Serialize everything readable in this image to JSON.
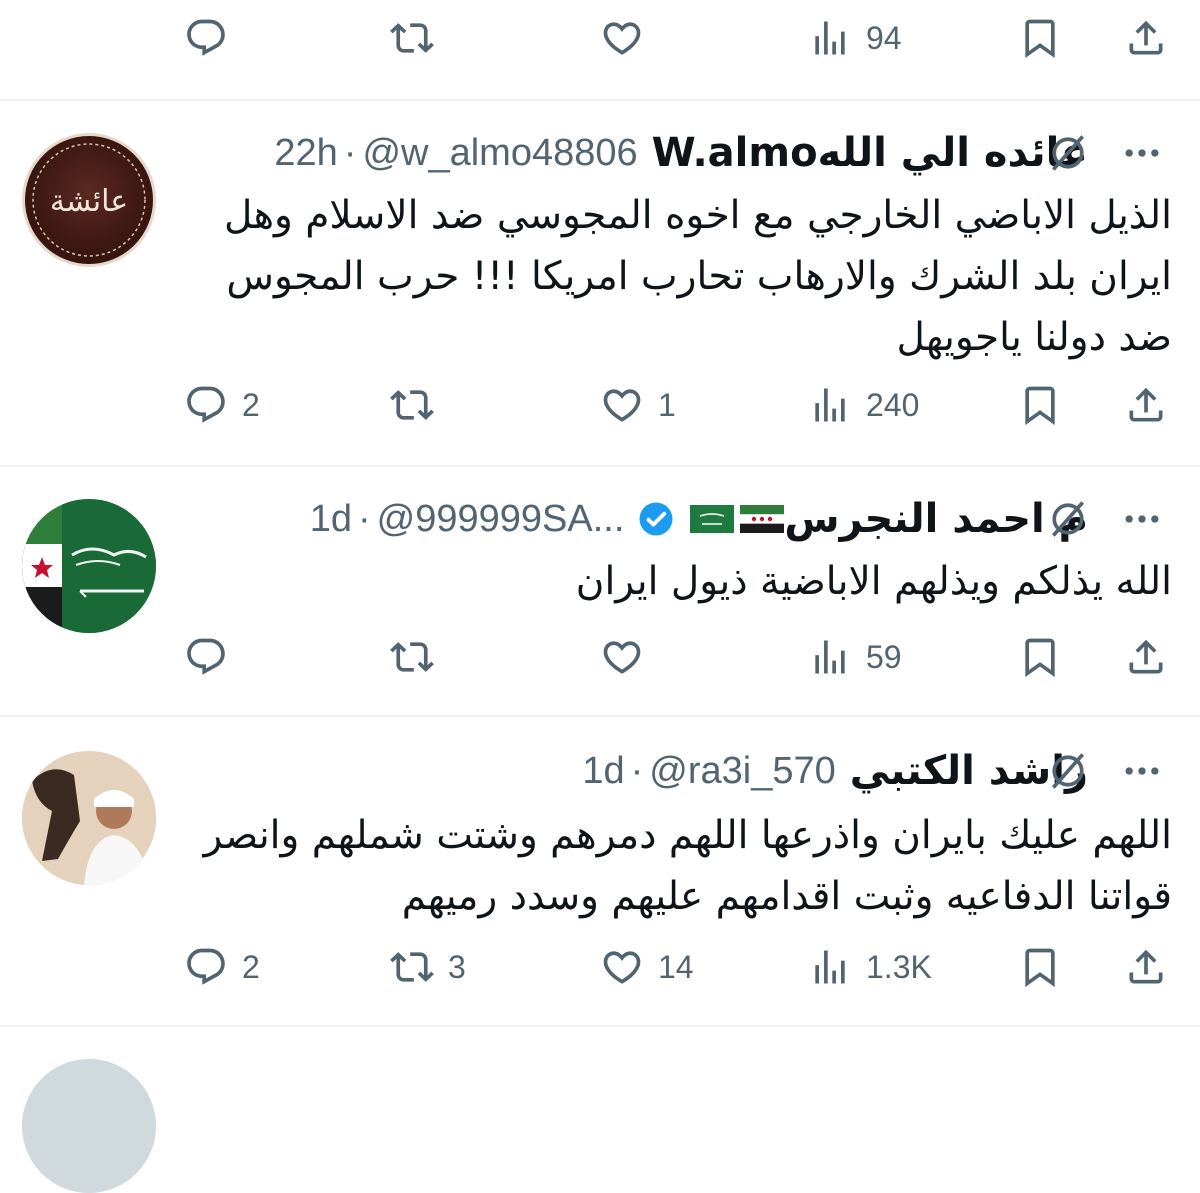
{
  "feed": {
    "top_actions": {
      "reply_count": "",
      "retweet_count": "",
      "like_count": "",
      "view_count": "94"
    },
    "tweets": [
      {
        "name": "عائده الي اللهW.almo",
        "handle": "@w_almo48806",
        "dot": "·",
        "time": "22h",
        "avatar_logo_text": "عائشة",
        "text": "الذيل الاباضي الخارجي مع اخوه المجوسي ضد الاسلام وهل ايران بلد الشرك والارهاب تحارب امريكا !!! حرب المجوس ضد دولنا ياجويهل",
        "reply_count": "2",
        "retweet_count": "",
        "like_count": "1",
        "view_count": "240"
      },
      {
        "name": "م احمد النجرس",
        "handle": "@999999SA...",
        "dot": "·",
        "time": "1d",
        "verified": true,
        "text": "الله يذلكم ويذلهم الاباضية ذيول ايران",
        "reply_count": "",
        "retweet_count": "",
        "like_count": "",
        "view_count": "59"
      },
      {
        "name": "راشد الكتبي",
        "handle": "@ra3i_570",
        "dot": "·",
        "time": "1d",
        "text": "اللهم عليك بايران واذرعها اللهم دمرهم وشتت شملهم وانصر قواتنا الدفاعيه وثبت اقدامهم عليهم وسدد رميهم",
        "reply_count": "2",
        "retweet_count": "3",
        "like_count": "14",
        "view_count": "1.3K"
      }
    ]
  },
  "colors": {
    "muted": "#536471",
    "text": "#0f1419",
    "verified": "#1d9bf0",
    "divider": "#eff3f4"
  },
  "icons": [
    "reply-icon",
    "retweet-icon",
    "like-icon",
    "views-icon",
    "bookmark-icon",
    "share-icon",
    "grok-icon",
    "more-icon",
    "verified-badge-icon"
  ]
}
